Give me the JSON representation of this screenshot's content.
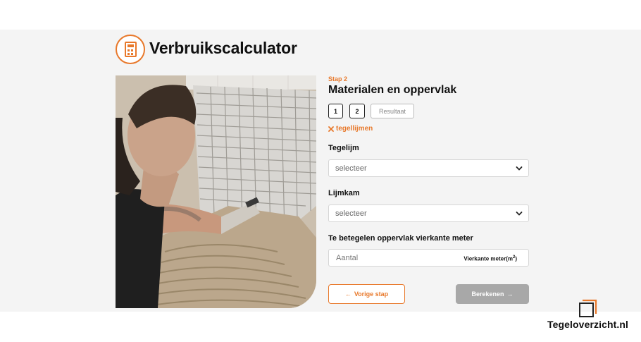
{
  "header": {
    "title": "Verbruikscalculator",
    "logo_icon": "calculator-icon",
    "accent": "#e8782a"
  },
  "form": {
    "step_label": "Stap 2",
    "step_title": "Materialen en oppervlak",
    "steps": [
      {
        "label": "1"
      },
      {
        "label": "2"
      },
      {
        "label": "Resultaat"
      }
    ],
    "remove_link": "tegellijmen",
    "tegellijm": {
      "label": "Tegelijm",
      "value": "selecteer"
    },
    "lijmkam": {
      "label": "Lijmkam",
      "value": "selecteer"
    },
    "oppervlak": {
      "label": "Te betegelen oppervlak vierkante meter",
      "placeholder": "Aantal",
      "unit": "Vierkante meter(m",
      "unit_sup": "2",
      "unit_close": ")"
    },
    "prev_button": "Vorige stap",
    "calc_button": "Berekenen"
  },
  "watermark": {
    "text": "Tegeloverzicht.nl"
  }
}
